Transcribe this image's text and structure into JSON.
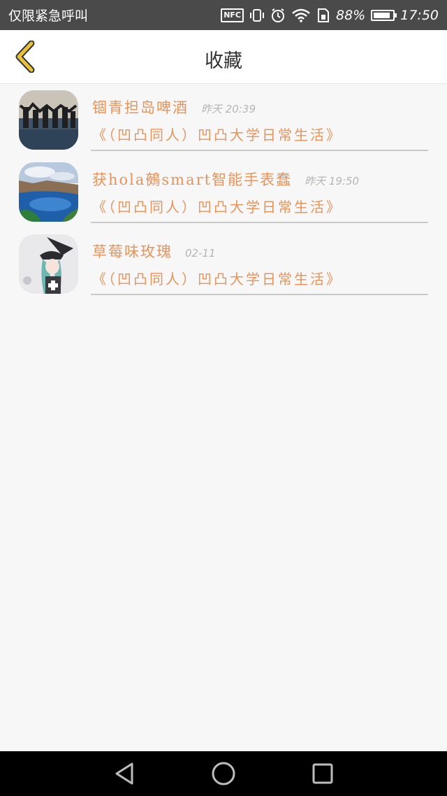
{
  "status_bar": {
    "carrier": "仅限紧急呼叫",
    "nfc_label": "NFC",
    "battery_percent": "88%",
    "battery_level": 0.88,
    "time": "17:50",
    "icons": [
      "nfc-icon",
      "vibrate-icon",
      "alarm-icon",
      "wifi-icon",
      "sim-icon",
      "battery-icon"
    ]
  },
  "header": {
    "title": "收藏",
    "back_icon": "chevron-left-icon",
    "accent_color": "#e8c23a"
  },
  "favorites": [
    {
      "name": "锢青担岛啤酒",
      "time": "昨天 20:39",
      "subtitle": "《（凹凸同人）凹凸大学日常生活》"
    },
    {
      "name": "获hola鵺smart智能手表蠢",
      "time": "昨天 19:50",
      "subtitle": "《（凹凸同人）凹凸大学日常生活》"
    },
    {
      "name": "草莓味玫瑰",
      "time": "02-11",
      "subtitle": "《（凹凸同人）凹凸大学日常生活》"
    }
  ],
  "colors": {
    "item_text": "#e8935a",
    "time_text": "#b5b5b5",
    "background": "#f7f7f7"
  },
  "nav_bar": {
    "icons": [
      "back-triangle-icon",
      "home-circle-icon",
      "recents-square-icon"
    ]
  }
}
